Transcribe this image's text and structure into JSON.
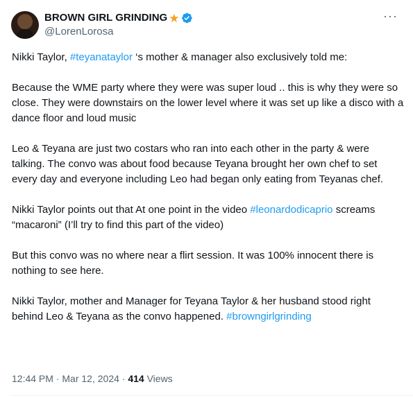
{
  "author": {
    "display_name": "BROWN GIRL GRINDING",
    "star": "★",
    "handle": "@LorenLorosa",
    "avatar_icon": "avatar-photo",
    "verified_color": "#1d9bf0"
  },
  "more_glyph": "···",
  "post": {
    "p1": {
      "t1": "Nikki Taylor, ",
      "tag1": "#teyanataylor",
      "t2": " ‘s mother & manager also exclusively told me:"
    },
    "p2": "Because the WME party where they were was super loud .. this is why they were so close. They were downstairs on the lower level where it was set up like a disco with a dance floor and loud music",
    "p3": "Leo & Teyana are just two costars who ran into each other in the party & were talking. The convo was about food because Teyana brought her own chef to set every day and everyone including Leo had began only eating from Teyanas chef.",
    "p4": {
      "t1": "Nikki Taylor points out that At one point in the video ",
      "tag1": "#leonardodicaprio",
      "t2": " screams “macaroni” (I’ll try to find this  part of the video)"
    },
    "p5": "But this convo was no where near a flirt session. It was 100% innocent there is nothing to see here.",
    "p6": {
      "t1": "Nikki Taylor, mother and Manager for Teyana Taylor & her husband stood right behind Leo & Teyana as the convo happened. ",
      "tag1": "#browngirlgrinding"
    }
  },
  "meta": {
    "time": "12:44 PM",
    "sep1": " · ",
    "date": "Mar 12, 2024",
    "sep2": " · ",
    "views_count": "414",
    "views_label": " Views"
  },
  "colors": {
    "link": "#1d9bf0",
    "secondary": "#536471",
    "primary": "#0f1419"
  }
}
